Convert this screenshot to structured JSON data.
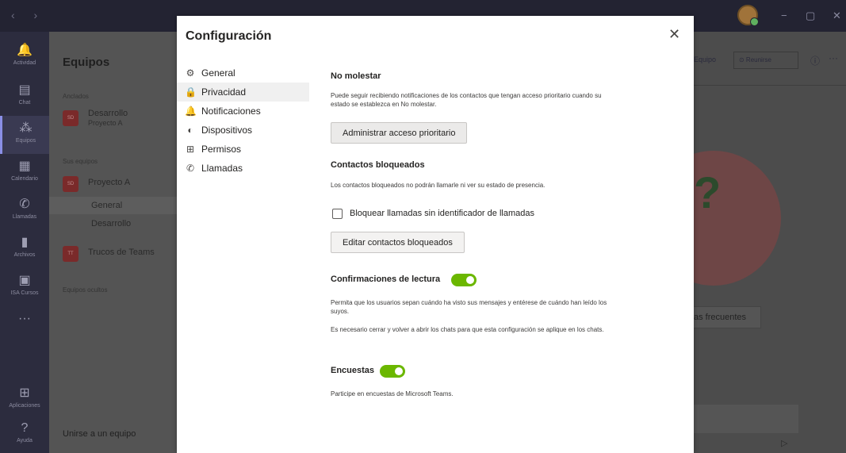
{
  "background": {
    "titlebar": {
      "nav": "‹ ›",
      "minimize": "−",
      "maximize": "▢",
      "close": "✕"
    },
    "rail": [
      {
        "label": "Actividad",
        "icon": "bell-icon",
        "glyph": "🔔",
        "active": false
      },
      {
        "label": "Chat",
        "icon": "chat-icon",
        "glyph": "▤",
        "active": false
      },
      {
        "label": "Equipos",
        "icon": "teams-icon",
        "glyph": "⁂",
        "active": true
      },
      {
        "label": "Calendario",
        "icon": "calendar-icon",
        "glyph": "▦",
        "active": false
      },
      {
        "label": "Llamadas",
        "icon": "phone-icon",
        "glyph": "✆",
        "active": false
      },
      {
        "label": "Archivos",
        "icon": "files-icon",
        "glyph": "▮",
        "active": false
      },
      {
        "label": "ISA Cursos",
        "icon": "app-icon",
        "glyph": "▣",
        "active": false
      },
      {
        "label": "",
        "icon": "more-icon",
        "glyph": "···",
        "active": false
      },
      {
        "label": "Aplicaciones",
        "icon": "apps-icon",
        "glyph": "⊞",
        "active": false
      },
      {
        "label": "Ayuda",
        "icon": "help-icon",
        "glyph": "?",
        "active": false
      }
    ],
    "teams_panel": {
      "title": "Equipos",
      "pinned_label": "Anclados",
      "pinned": {
        "badge": "SD",
        "name": "Desarrollo",
        "sub": "Proyecto A"
      },
      "your_teams_label": "Sus equipos",
      "team1": {
        "badge": "SD",
        "name": "Proyecto A"
      },
      "channels": [
        "General",
        "Desarrollo"
      ],
      "team2": {
        "badge": "TT",
        "name": "Trucos de Teams"
      },
      "hidden_label": "Equipos ocultos",
      "join": "Unirse a un equipo"
    },
    "right": {
      "team_btn": "Equipo",
      "meet_btn": "⊙ Reunirse",
      "faq_btn": "as frecuentes"
    }
  },
  "dialog": {
    "title": "Configuración",
    "nav": [
      {
        "label": "General",
        "icon": "gear-icon",
        "glyph": "⚙",
        "active": false
      },
      {
        "label": "Privacidad",
        "icon": "lock-icon",
        "glyph": "🔒",
        "active": true
      },
      {
        "label": "Notificaciones",
        "icon": "bell-icon",
        "glyph": "🔔",
        "active": false
      },
      {
        "label": "Dispositivos",
        "icon": "headset-icon",
        "glyph": "◐",
        "active": false
      },
      {
        "label": "Permisos",
        "icon": "permissions-icon",
        "glyph": "⊞",
        "active": false
      },
      {
        "label": "Llamadas",
        "icon": "phone-icon",
        "glyph": "✆",
        "active": false
      }
    ],
    "dnd": {
      "heading": "No molestar",
      "text": "Puede seguir recibiendo notificaciones de los contactos que tengan acceso prioritario cuando su estado se establezca en No molestar.",
      "button": "Administrar acceso prioritario"
    },
    "blocked": {
      "heading": "Contactos bloqueados",
      "text": "Los contactos bloqueados no podrán llamarle ni ver su estado de presencia.",
      "checkbox_label": "Bloquear llamadas sin identificador de llamadas",
      "checked": false,
      "button": "Editar contactos bloqueados"
    },
    "read_receipts": {
      "heading": "Confirmaciones de lectura",
      "enabled": true,
      "text1": "Permita que los usuarios sepan cuándo ha visto sus mensajes y entérese de cuándo han leído los suyos.",
      "text2": "Es necesario cerrar y volver a abrir los chats para que esta configuración se aplique en los chats."
    },
    "surveys": {
      "heading": "Encuestas",
      "enabled": true,
      "text": "Participe en encuestas de Microsoft Teams."
    },
    "accent_color": "#6bb700"
  }
}
